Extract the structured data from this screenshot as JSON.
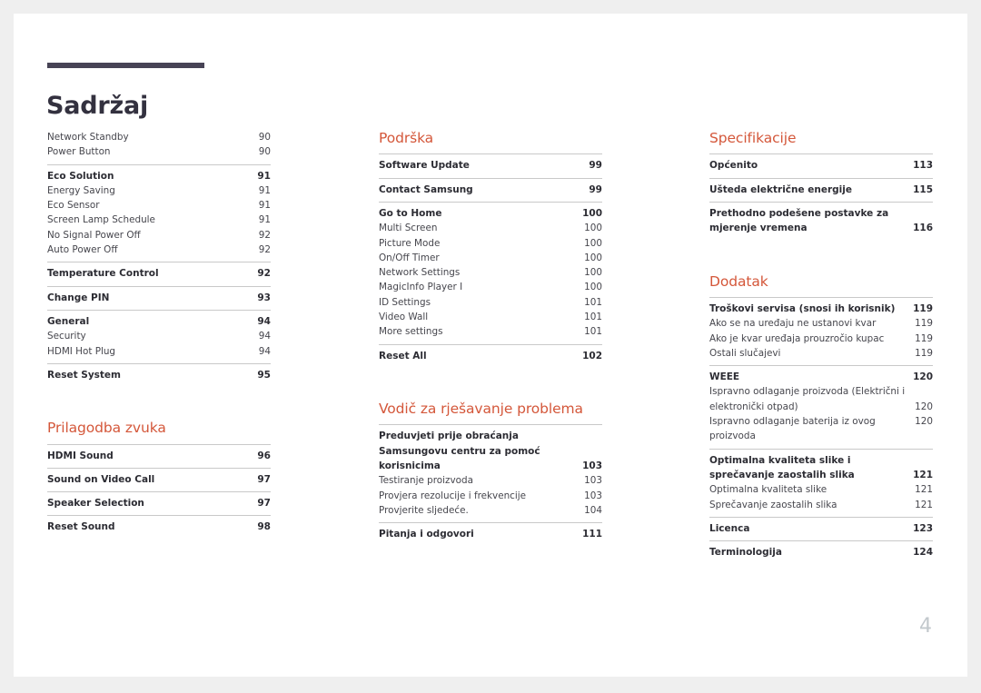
{
  "document": {
    "title": "Sadržaj",
    "folio": "4",
    "accent_color": "#d4573a",
    "title_rule_color": "#474355",
    "rule_color": "#c9c9c9",
    "folio_color": "#c2c8cc"
  },
  "columns": [
    {
      "name": "column-left",
      "groups": [
        {
          "heading": null,
          "blocks": [
            {
              "rule": false,
              "rows": [
                {
                  "label": "Network Standby",
                  "page": "90",
                  "style": "sub"
                },
                {
                  "label": "Power Button",
                  "page": "90",
                  "style": "sub"
                }
              ]
            },
            {
              "rule": true,
              "rows": [
                {
                  "label": "Eco Solution",
                  "page": "91",
                  "style": "bold"
                },
                {
                  "label": "Energy Saving",
                  "page": "91",
                  "style": "sub"
                },
                {
                  "label": "Eco Sensor",
                  "page": "91",
                  "style": "sub"
                },
                {
                  "label": "Screen Lamp Schedule",
                  "page": "91",
                  "style": "sub"
                },
                {
                  "label": "No Signal Power Off",
                  "page": "92",
                  "style": "sub"
                },
                {
                  "label": "Auto Power Off",
                  "page": "92",
                  "style": "sub"
                }
              ]
            },
            {
              "rule": true,
              "rows": [
                {
                  "label": "Temperature Control",
                  "page": "92",
                  "style": "bold"
                }
              ]
            },
            {
              "rule": true,
              "rows": [
                {
                  "label": "Change PIN",
                  "page": "93",
                  "style": "bold"
                }
              ]
            },
            {
              "rule": true,
              "rows": [
                {
                  "label": "General",
                  "page": "94",
                  "style": "bold"
                },
                {
                  "label": "Security",
                  "page": "94",
                  "style": "sub"
                },
                {
                  "label": "HDMI Hot Plug",
                  "page": "94",
                  "style": "sub"
                }
              ]
            },
            {
              "rule": true,
              "rows": [
                {
                  "label": "Reset System",
                  "page": "95",
                  "style": "bold"
                }
              ]
            }
          ]
        },
        {
          "heading": "Prilagodba zvuka",
          "spacer": true,
          "blocks": [
            {
              "rule": true,
              "rows": [
                {
                  "label": "HDMI Sound",
                  "page": "96",
                  "style": "bold"
                }
              ]
            },
            {
              "rule": true,
              "rows": [
                {
                  "label": "Sound on Video Call",
                  "page": "97",
                  "style": "bold"
                }
              ]
            },
            {
              "rule": true,
              "rows": [
                {
                  "label": "Speaker Selection",
                  "page": "97",
                  "style": "bold"
                }
              ]
            },
            {
              "rule": true,
              "rows": [
                {
                  "label": "Reset Sound",
                  "page": "98",
                  "style": "bold"
                }
              ]
            }
          ]
        }
      ]
    },
    {
      "name": "column-middle",
      "groups": [
        {
          "heading": "Podrška",
          "blocks": [
            {
              "rule": true,
              "rows": [
                {
                  "label": "Software Update",
                  "page": "99",
                  "style": "bold"
                }
              ]
            },
            {
              "rule": true,
              "rows": [
                {
                  "label": "Contact Samsung",
                  "page": "99",
                  "style": "bold"
                }
              ]
            },
            {
              "rule": true,
              "rows": [
                {
                  "label": "Go to Home",
                  "page": "100",
                  "style": "bold"
                },
                {
                  "label": "Multi Screen",
                  "page": "100",
                  "style": "sub"
                },
                {
                  "label": "Picture Mode",
                  "page": "100",
                  "style": "sub"
                },
                {
                  "label": "On/Off Timer",
                  "page": "100",
                  "style": "sub"
                },
                {
                  "label": "Network Settings",
                  "page": "100",
                  "style": "sub"
                },
                {
                  "label": "MagicInfo Player I",
                  "page": "100",
                  "style": "sub"
                },
                {
                  "label": "ID Settings",
                  "page": "101",
                  "style": "sub"
                },
                {
                  "label": "Video Wall",
                  "page": "101",
                  "style": "sub"
                },
                {
                  "label": "More settings",
                  "page": "101",
                  "style": "sub"
                }
              ]
            },
            {
              "rule": true,
              "rows": [
                {
                  "label": "Reset All",
                  "page": "102",
                  "style": "bold"
                }
              ]
            }
          ]
        },
        {
          "heading": "Vodič za rješavanje problema",
          "spacer": true,
          "blocks": [
            {
              "rule": true,
              "rows": [
                {
                  "label": "Preduvjeti prije obraćanja Samsungovu centru za pomoć korisnicima",
                  "page": "103",
                  "style": "bold",
                  "wrap": true
                },
                {
                  "label": "Testiranje proizvoda",
                  "page": "103",
                  "style": "sub"
                },
                {
                  "label": "Provjera rezolucije i frekvencije",
                  "page": "103",
                  "style": "sub"
                },
                {
                  "label": "Provjerite sljedeće.",
                  "page": "104",
                  "style": "sub"
                }
              ]
            },
            {
              "rule": true,
              "rows": [
                {
                  "label": "Pitanja i odgovori",
                  "page": "111",
                  "style": "bold"
                }
              ]
            }
          ]
        }
      ]
    },
    {
      "name": "column-right",
      "groups": [
        {
          "heading": "Specifikacije",
          "blocks": [
            {
              "rule": true,
              "rows": [
                {
                  "label": "Općenito",
                  "page": "113",
                  "style": "bold"
                }
              ]
            },
            {
              "rule": true,
              "rows": [
                {
                  "label": "Ušteda električne energije",
                  "page": "115",
                  "style": "bold"
                }
              ]
            },
            {
              "rule": true,
              "rows": [
                {
                  "label": "Prethodno podešene postavke za mjerenje vremena",
                  "page": "116",
                  "style": "bold",
                  "wrap": true
                }
              ]
            }
          ]
        },
        {
          "heading": "Dodatak",
          "spacer": true,
          "blocks": [
            {
              "rule": true,
              "rows": [
                {
                  "label": "Troškovi servisa (snosi ih korisnik)",
                  "page": "119",
                  "style": "bold",
                  "wrap": true
                },
                {
                  "label": "Ako se na uređaju ne ustanovi kvar",
                  "page": "119",
                  "style": "sub"
                },
                {
                  "label": "Ako je kvar uređaja prouzročio kupac",
                  "page": "119",
                  "style": "sub"
                },
                {
                  "label": "Ostali slučajevi",
                  "page": "119",
                  "style": "sub"
                }
              ]
            },
            {
              "rule": true,
              "rows": [
                {
                  "label": "WEEE",
                  "page": "120",
                  "style": "bold"
                },
                {
                  "label": "Ispravno odlaganje proizvoda (Električni i elektronički otpad)",
                  "page": "120",
                  "style": "sub",
                  "wrap": true
                },
                {
                  "label": "Ispravno odlaganje baterija iz ovog proizvoda",
                  "page": "120",
                  "style": "sub"
                }
              ]
            },
            {
              "rule": true,
              "rows": [
                {
                  "label": "Optimalna kvaliteta slike i sprečavanje zaostalih slika",
                  "page": "121",
                  "style": "bold",
                  "wrap": true
                },
                {
                  "label": "Optimalna kvaliteta slike",
                  "page": "121",
                  "style": "sub"
                },
                {
                  "label": "Sprečavanje zaostalih slika",
                  "page": "121",
                  "style": "sub"
                }
              ]
            },
            {
              "rule": true,
              "rows": [
                {
                  "label": "Licenca",
                  "page": "123",
                  "style": "bold"
                }
              ]
            },
            {
              "rule": true,
              "rows": [
                {
                  "label": "Terminologija",
                  "page": "124",
                  "style": "bold"
                }
              ]
            }
          ]
        }
      ]
    }
  ]
}
